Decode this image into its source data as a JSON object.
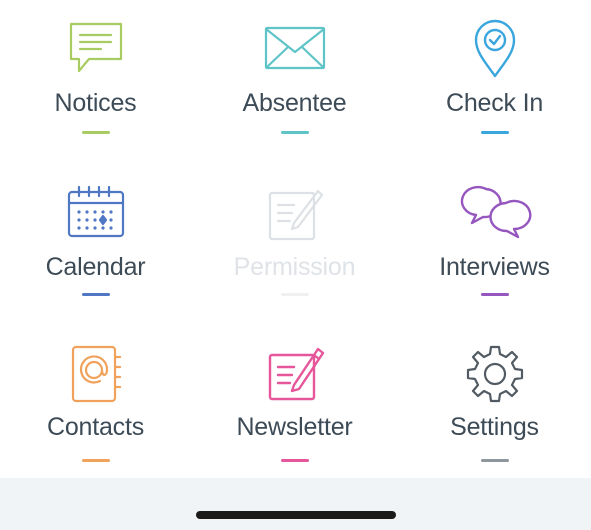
{
  "menu": {
    "items": [
      {
        "key": "notices",
        "label": "Notices",
        "icon": "speech-bubble-icon",
        "color": "#a8cc62",
        "enabled": true
      },
      {
        "key": "absentee",
        "label": "Absentee",
        "icon": "envelope-icon",
        "color": "#5fc4c8",
        "enabled": true
      },
      {
        "key": "check-in",
        "label": "Check In",
        "icon": "location-pin-icon",
        "color": "#3aa6de",
        "enabled": true
      },
      {
        "key": "calendar",
        "label": "Calendar",
        "icon": "calendar-icon",
        "color": "#4f77c4",
        "enabled": true
      },
      {
        "key": "permission",
        "label": "Permission",
        "icon": "edit-document-icon",
        "color": "#dde1e5",
        "enabled": false
      },
      {
        "key": "interviews",
        "label": "Interviews",
        "icon": "chat-bubbles-icon",
        "color": "#9556be",
        "enabled": true
      },
      {
        "key": "contacts",
        "label": "Contacts",
        "icon": "address-book-icon",
        "color": "#f0a25c",
        "enabled": true
      },
      {
        "key": "newsletter",
        "label": "Newsletter",
        "icon": "newsletter-edit-icon",
        "color": "#e5569b",
        "enabled": true
      },
      {
        "key": "settings",
        "label": "Settings",
        "icon": "gear-icon",
        "color": "#525b63",
        "enabled": true
      }
    ]
  },
  "colors": {
    "label_text": "#3d4b57",
    "label_disabled": "#dfe3e7",
    "footer_background": "#f1f4f6",
    "home_indicator": "#1a1a1a",
    "settings_underline": "#8e969d"
  }
}
